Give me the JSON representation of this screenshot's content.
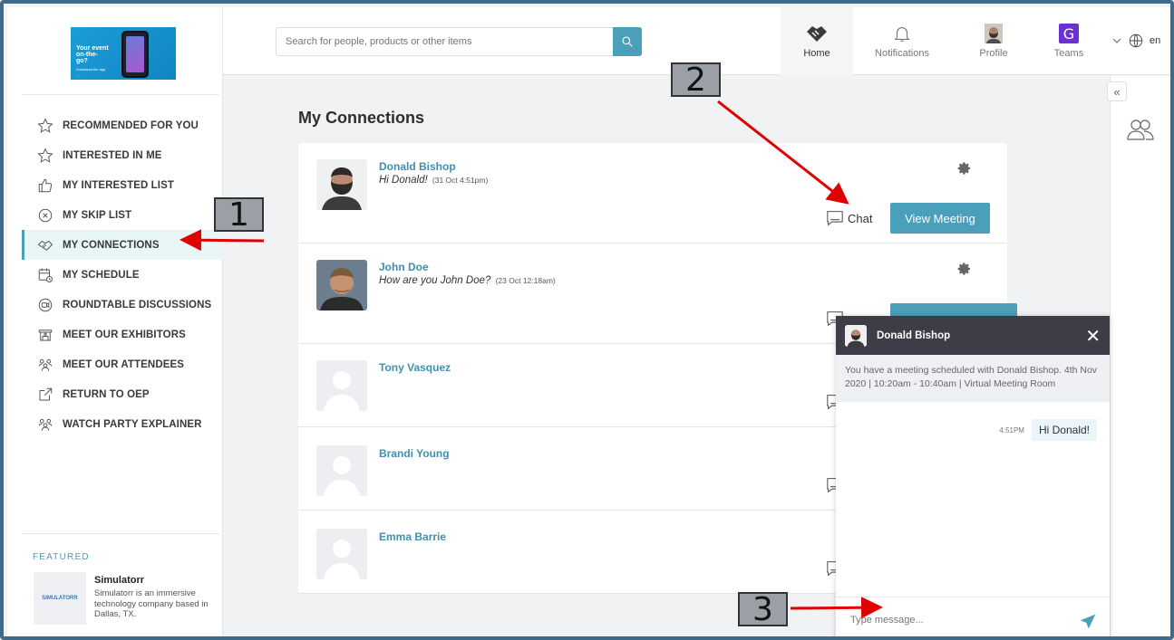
{
  "promo": {
    "headline": "Your event on-the-go?",
    "sub": "Download the app →"
  },
  "sidebar": {
    "items": [
      {
        "label": "RECOMMENDED FOR YOU",
        "icon": "star-icon"
      },
      {
        "label": "INTERESTED IN ME",
        "icon": "star-icon"
      },
      {
        "label": "MY INTERESTED LIST",
        "icon": "thumbs-up-icon"
      },
      {
        "label": "MY SKIP LIST",
        "icon": "x-circle-icon"
      },
      {
        "label": "MY CONNECTIONS",
        "icon": "handshake-icon",
        "active": true
      },
      {
        "label": "MY SCHEDULE",
        "icon": "calendar-clock-icon"
      },
      {
        "label": "ROUNDTABLE DISCUSSIONS",
        "icon": "video-icon"
      },
      {
        "label": "MEET OUR EXHIBITORS",
        "icon": "booth-icon"
      },
      {
        "label": "MEET OUR ATTENDEES",
        "icon": "group-icon"
      },
      {
        "label": "RETURN TO OEP",
        "icon": "external-link-icon"
      },
      {
        "label": "WATCH PARTY EXPLAINER",
        "icon": "group-icon"
      }
    ],
    "featured": {
      "label": "FEATURED",
      "logo": "SIMULATORR",
      "title": "Simulatorr",
      "description": "Simulatorr is an immersive technology company based in Dallas, TX."
    }
  },
  "header": {
    "search_placeholder": "Search for people, products or other items",
    "nav": {
      "home": "Home",
      "notifications": "Notifications",
      "profile": "Profile",
      "teams": "Teams"
    },
    "language": "en"
  },
  "main": {
    "title": "My Connections",
    "connections": [
      {
        "name": "Donald Bishop",
        "message": "Hi Donald!",
        "time": "(31 Oct 4:51pm)",
        "has_photo": true
      },
      {
        "name": "John Doe",
        "message": "How are you John Doe?",
        "time": "(23 Oct 12:18am)",
        "has_photo": true
      },
      {
        "name": "Tony Vasquez",
        "message": "",
        "time": "",
        "has_photo": false
      },
      {
        "name": "Brandi Young",
        "message": "",
        "time": "",
        "has_photo": false
      },
      {
        "name": "Emma Barrie",
        "message": "",
        "time": "",
        "has_photo": false
      }
    ],
    "chat_label": "Chat",
    "view_meeting_label": "View Meeting"
  },
  "chat_panel": {
    "name": "Donald Bishop",
    "meeting_note": "You have a meeting scheduled with Donald Bishop. 4th Nov 2020 | 10:20am - 10:40am | Virtual Meeting Room",
    "messages": [
      {
        "time": "4:51PM",
        "text": "Hi Donald!"
      }
    ],
    "input_placeholder": "Type message..."
  },
  "annotations": {
    "m1": "1",
    "m2": "2",
    "m3": "3"
  },
  "colors": {
    "accent": "#4a9fbb",
    "annotation_arrow": "#e00000",
    "chat_header": "#3f3b47"
  }
}
